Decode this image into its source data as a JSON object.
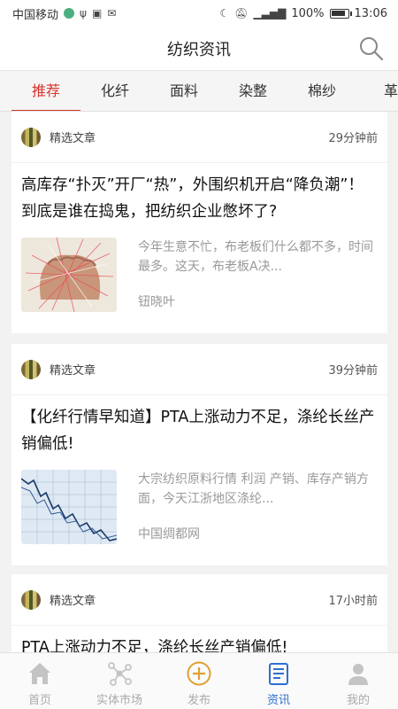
{
  "status_bar": {
    "carrier": "中国移动",
    "battery": "100%",
    "time": "13:06"
  },
  "header": {
    "title": "纺织资讯"
  },
  "tabs": [
    {
      "label": "推荐",
      "active": true
    },
    {
      "label": "化纤",
      "active": false
    },
    {
      "label": "面料",
      "active": false
    },
    {
      "label": "染整",
      "active": false
    },
    {
      "label": "棉纱",
      "active": false
    },
    {
      "label": "革",
      "active": false
    }
  ],
  "articles": [
    {
      "source_label": "精选文章",
      "time": "29分钟前",
      "title": "高库存“扑灭”开厂“热”，外围织机开启“降负潮”！到底是谁在捣鬼，把纺织企业憋坏了?",
      "summary": "今年生意不忙，布老板们什么都不多，时间最多。这天，布老板A决...",
      "author": "钮晓叶",
      "thumb": "fist-with-yarn"
    },
    {
      "source_label": "精选文章",
      "time": "39分钟前",
      "title": "【化纤行情早知道】PTA上涨动力不足，涤纶长丝产销偏低!",
      "summary": "大宗纺织原料行情 利润 产销、库存产销方面，今天江浙地区涤纶...",
      "author": "中国绸都网",
      "thumb": "stock-chart"
    },
    {
      "source_label": "精选文章",
      "time": "17小时前",
      "title": "PTA上涨动力不足，涤纶长丝产销偏低!"
    }
  ],
  "bottom_nav": [
    {
      "label": "首页",
      "icon": "home-icon",
      "active": false
    },
    {
      "label": "实体市场",
      "icon": "network-icon",
      "active": false
    },
    {
      "label": "发布",
      "icon": "plus-circle-icon",
      "active": false
    },
    {
      "label": "资讯",
      "icon": "news-icon",
      "active": true
    },
    {
      "label": "我的",
      "icon": "person-icon",
      "active": false
    }
  ],
  "colors": {
    "accent_red": "#d9322a",
    "active_blue": "#2f6fd0",
    "publish_orange": "#e0a030"
  }
}
